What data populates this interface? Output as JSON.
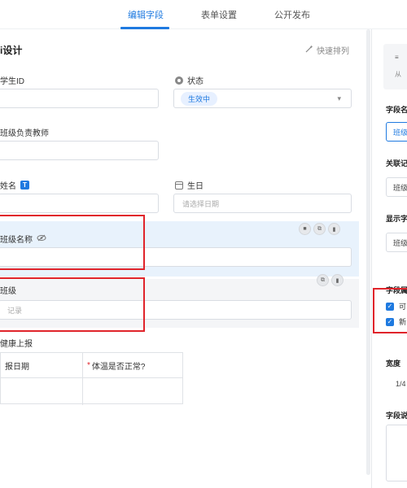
{
  "tabs": [
    {
      "label": "编辑字段",
      "active": true
    },
    {
      "label": "表单设置",
      "active": false
    },
    {
      "label": "公开发布",
      "active": false
    }
  ],
  "canvas": {
    "title": "i设计",
    "quick_sort": "快速排列",
    "fields": {
      "student_id": {
        "label": "学生ID"
      },
      "status": {
        "label": "状态",
        "value": "生效中"
      },
      "teacher": {
        "label": "班级负责教师"
      },
      "name": {
        "label": "姓名",
        "badge": "T"
      },
      "birthday": {
        "label": "生日",
        "placeholder": "请选择日期"
      },
      "class_name": {
        "label": "班级名称"
      },
      "class": {
        "label": "班级",
        "placeholder": "记录"
      },
      "health": {
        "label": "健康上报",
        "col1": "报日期",
        "col2": "体温是否正常?",
        "col2_required": "*"
      }
    }
  },
  "panel": {
    "type_snippet": "从",
    "field_name_label": "字段名",
    "field_name_value": "班级",
    "related_label": "关联记",
    "related_value": "班级",
    "display_label": "显示字",
    "display_value": "班级",
    "field_perm_label": "字段属",
    "check1": "可",
    "check2": "新",
    "width_label": "宽度",
    "width_value": "1/4",
    "desc_label": "字段说"
  },
  "colors": {
    "accent": "#1f7ae0",
    "highlight": "#e0242b"
  }
}
